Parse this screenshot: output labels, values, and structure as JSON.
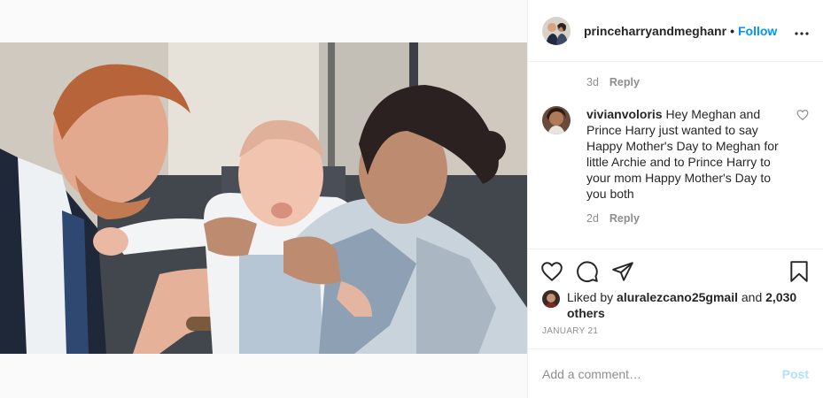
{
  "post": {
    "username": "princeharryandmeghanr",
    "separator": "•",
    "follow_label": "Follow",
    "more_label": "•••"
  },
  "comments": [
    {
      "time": "3d",
      "reply_label": "Reply"
    },
    {
      "author": "vivianvoloris",
      "text": "Hey Meghan and Prince Harry just wanted to say Happy Mother's Day to Meghan for little Archie and to Prince Harry to your mom Happy Mother's Day to you both",
      "time": "2d",
      "reply_label": "Reply"
    }
  ],
  "likes": {
    "prefix": "Liked by",
    "user": "aluralezcano25gmail",
    "joiner": "and",
    "others": "2,030 others"
  },
  "date": "JANUARY 21",
  "add_comment": {
    "placeholder": "Add a comment…",
    "post_label": "Post"
  },
  "colors": {
    "accent": "#0095f6",
    "post_disabled": "#b2dffc",
    "muted": "#8e8e8e"
  },
  "icons": [
    "heart-icon",
    "comment-icon",
    "share-icon",
    "bookmark-icon",
    "more-icon"
  ]
}
